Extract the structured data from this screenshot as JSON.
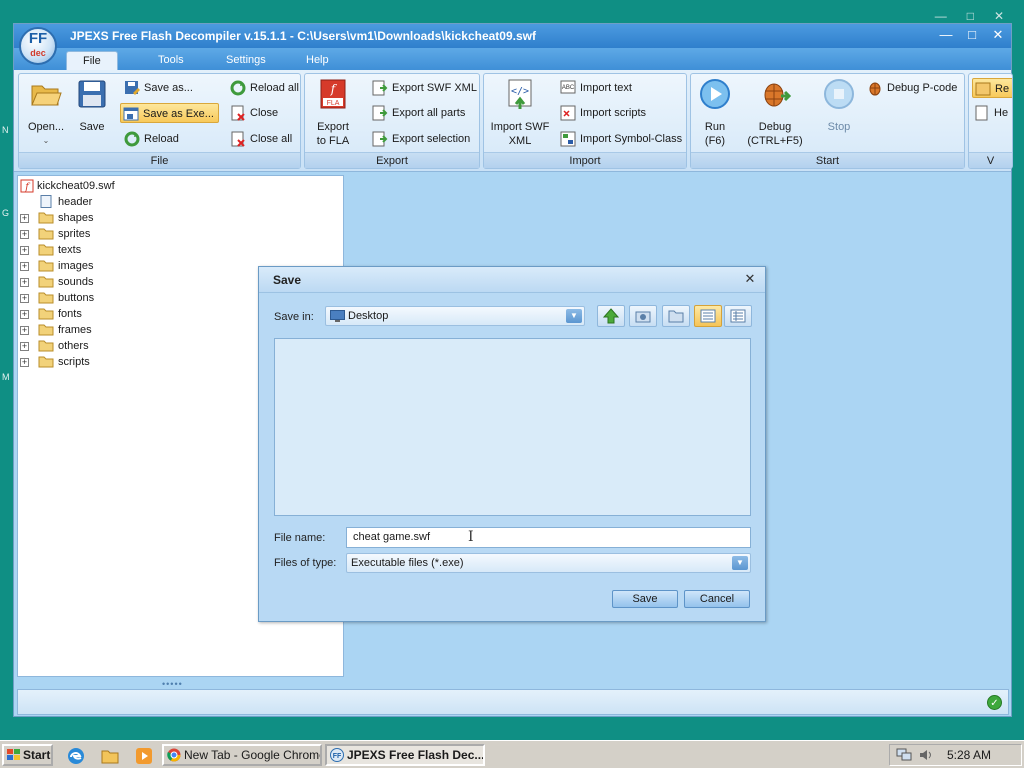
{
  "window": {
    "title": "JPEXS Free Flash Decompiler v.15.1.1 - C:\\Users\\vm1\\Downloads\\kickcheat09.swf",
    "logo_text": "FF",
    "logo_sub": "dec"
  },
  "ribbon_tabs": [
    "File",
    "Tools",
    "Settings",
    "Help"
  ],
  "ribbon": {
    "file_group": {
      "label": "File",
      "open": "Open...",
      "save": "Save",
      "save_as": "Save as...",
      "save_as_exe": "Save as Exe...",
      "reload": "Reload",
      "reload_all": "Reload all",
      "close": "Close",
      "close_all": "Close all"
    },
    "export_group": {
      "label": "Export",
      "export_fla_1": "Export",
      "export_fla_2": "to FLA",
      "export_swf_xml": "Export SWF XML",
      "export_all_parts": "Export all parts",
      "export_selection": "Export selection"
    },
    "import_group": {
      "label": "Import",
      "import_swf_xml_1": "Import SWF",
      "import_swf_xml_2": "XML",
      "import_text": "Import text",
      "import_scripts": "Import scripts",
      "import_symbol_class": "Import Symbol-Class"
    },
    "start_group": {
      "label": "Start",
      "run_1": "Run",
      "run_2": "(F6)",
      "debug_1": "Debug",
      "debug_2": "(CTRL+F5)",
      "stop": "Stop",
      "debug_pcode": "Debug P-code"
    },
    "view_group": {
      "label": "V",
      "item1": "Re",
      "item2": "He"
    }
  },
  "tree": {
    "root": "kickcheat09.swf",
    "items": [
      "header",
      "shapes",
      "sprites",
      "texts",
      "images",
      "sounds",
      "buttons",
      "fonts",
      "frames",
      "others",
      "scripts"
    ]
  },
  "dialog": {
    "title": "Save",
    "save_in_label": "Save in:",
    "save_in_value": "Desktop",
    "file_name_label": "File name:",
    "file_name_value": "cheat game.swf",
    "files_of_type_label": "Files of type:",
    "files_of_type_value": "Executable files (*.exe)",
    "save_button": "Save",
    "cancel_button": "Cancel"
  },
  "taskbar": {
    "start": "Start",
    "tasks": [
      "New Tab - Google Chrome",
      "JPEXS Free Flash Dec..."
    ],
    "clock": "5:28 AM"
  },
  "desktop_letters": [
    "N",
    "G",
    "M"
  ]
}
